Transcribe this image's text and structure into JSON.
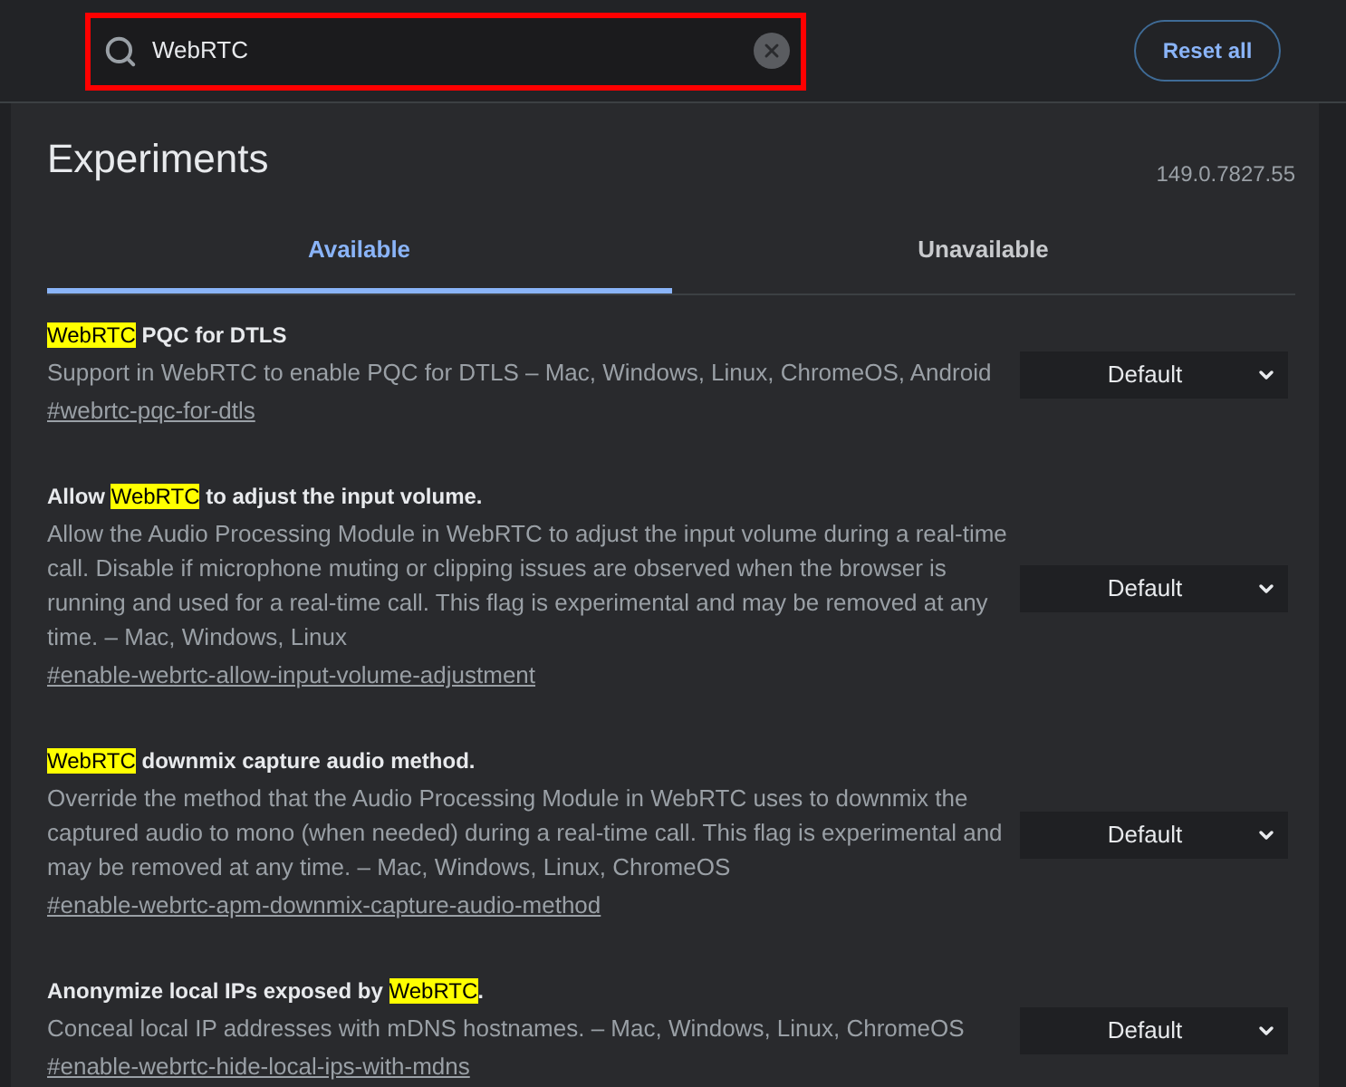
{
  "search": {
    "value": "WebRTC",
    "outlined": true
  },
  "reset_button": "Reset all",
  "header": {
    "title": "Experiments",
    "version": "149.0.7827.55"
  },
  "tabs": [
    {
      "label": "Available",
      "selected": true
    },
    {
      "label": "Unavailable",
      "selected": false
    }
  ],
  "experiments": [
    {
      "title_parts": [
        {
          "text": "WebRTC",
          "match": true
        },
        {
          "text": " PQC for DTLS",
          "match": false
        }
      ],
      "description": "Support in WebRTC to enable PQC for DTLS – Mac, Windows, Linux, ChromeOS, Android",
      "link": "#webrtc-pqc-for-dtls",
      "value": "Default"
    },
    {
      "title_parts": [
        {
          "text": "Allow ",
          "match": false
        },
        {
          "text": "WebRTC",
          "match": true
        },
        {
          "text": " to adjust the input volume.",
          "match": false
        }
      ],
      "description": "Allow the Audio Processing Module in WebRTC to adjust the input volume during a real-time call. Disable if microphone muting or clipping issues are observed when the browser is running and used for a real-time call. This flag is experimental and may be removed at any time. – Mac, Windows, Linux",
      "link": "#enable-webrtc-allow-input-volume-adjustment",
      "value": "Default"
    },
    {
      "title_parts": [
        {
          "text": "WebRTC",
          "match": true
        },
        {
          "text": " downmix capture audio method.",
          "match": false
        }
      ],
      "description": "Override the method that the Audio Processing Module in WebRTC uses to downmix the captured audio to mono (when needed) during a real-time call. This flag is experimental and may be removed at any time. – Mac, Windows, Linux, ChromeOS",
      "link": "#enable-webrtc-apm-downmix-capture-audio-method",
      "value": "Default"
    },
    {
      "title_parts": [
        {
          "text": "Anonymize local IPs exposed by ",
          "match": false
        },
        {
          "text": "WebRTC",
          "match": true
        },
        {
          "text": ".",
          "match": false
        }
      ],
      "description": "Conceal local IP addresses with mDNS hostnames. – Mac, Windows, Linux, ChromeOS",
      "link": "#enable-webrtc-hide-local-ips-with-mdns",
      "value": "Default"
    }
  ]
}
